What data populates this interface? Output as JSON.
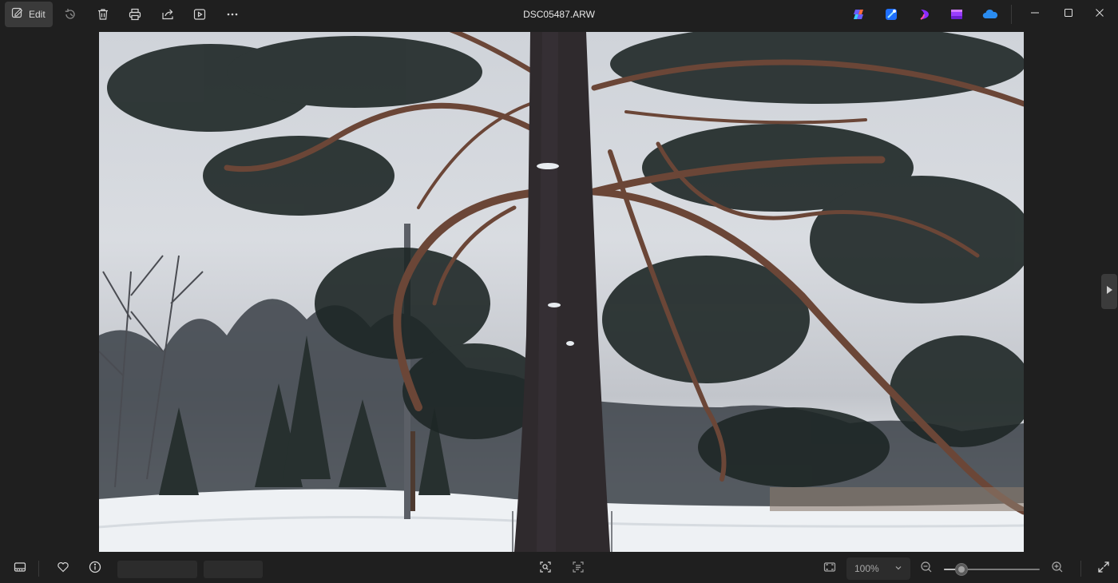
{
  "window": {
    "title": "DSC05487.ARW"
  },
  "toolbar": {
    "edit_label": "Edit",
    "icons": [
      "edit-icon",
      "rotate-icon",
      "delete-icon",
      "print-icon",
      "share-icon",
      "slideshow-icon",
      "more-icon"
    ]
  },
  "apps": [
    {
      "name": "copilot-app-icon",
      "color": "#7a5cff"
    },
    {
      "name": "designer-app-icon",
      "color": "#2f8cff"
    },
    {
      "name": "clipchamp-app-icon",
      "color": "#9b3cff"
    },
    {
      "name": "video-app-icon",
      "color": "#a24cff"
    },
    {
      "name": "onedrive-app-icon",
      "color": "#2a8cf0"
    }
  ],
  "bottombar": {
    "zoom_value": "100%",
    "zoom_level": 0.18,
    "icons": [
      "filmstrip-icon",
      "favorite-icon",
      "info-icon",
      "visual-search-icon",
      "text-extract-icon",
      "fit-to-window-icon",
      "zoom-out-icon",
      "zoom-in-icon",
      "fullscreen-icon"
    ]
  },
  "colors": {
    "background": "#1f1f1f",
    "edit_button_bg": "#3a3a3a",
    "placeholder_bg": "#2c2c2c"
  }
}
